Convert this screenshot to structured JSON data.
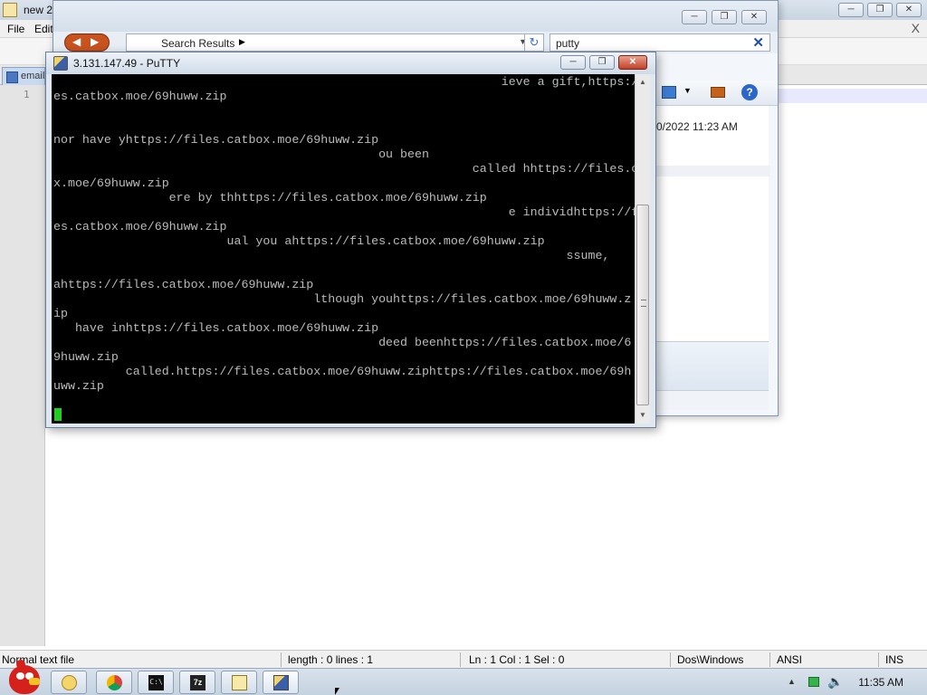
{
  "notepad": {
    "title": "new 2",
    "menu": {
      "file": "File",
      "edit": "Edit"
    },
    "close_glyph": "X",
    "tab_label": "email",
    "line_number": "1",
    "status": {
      "file_type": "Normal text file",
      "length_lines": "length : 0    lines : 1",
      "position": "Ln : 1    Col : 1    Sel : 0",
      "eol": "Dos\\Windows",
      "encoding": "ANSI",
      "mode": "INS"
    }
  },
  "explorer": {
    "address": "Search Results",
    "search_value": "putty",
    "date_text": "0/2022 11:23 AM",
    "icons": [
      "back-forward-icon",
      "refresh-icon",
      "clear-search-icon",
      "view-icon",
      "preview-pane-icon",
      "help-icon"
    ]
  },
  "putty": {
    "title": "3.131.147.49 - PuTTY",
    "terminal_lines": [
      "                                                              ieve a gift,https://fil",
      "es.catbox.moe/69huww.zip",
      "",
      "",
      "nor have yhttps://files.catbox.moe/69huww.zip",
      "                                             ou been",
      "                                                          called hhttps://files.catbo",
      "x.moe/69huww.zip",
      "                ere by thhttps://files.catbox.moe/69huww.zip",
      "                                                               e individhttps://fil",
      "es.catbox.moe/69huww.zip",
      "                        ual you ahttps://files.catbox.moe/69huww.zip",
      "                                                                       ssume,",
      "",
      "ahttps://files.catbox.moe/69huww.zip",
      "                                    lthough youhttps://files.catbox.moe/69huww.z",
      "ip",
      "   have inhttps://files.catbox.moe/69huww.zip",
      "                                             deed beenhttps://files.catbox.moe/6",
      "9huww.zip",
      "          called.https://files.catbox.moe/69huww.ziphttps://files.catbox.moe/69h",
      "uww.zip"
    ]
  },
  "taskbar": {
    "clock": "11:35 AM",
    "apps": [
      "start-button",
      "explorer-icon",
      "chrome-icon",
      "cmd-icon",
      "7zip-icon",
      "notepadpp-icon",
      "putty-icon"
    ],
    "cmd_glyph": "C:\\",
    "zip_glyph": "7z"
  },
  "colors": {
    "terminal_bg": "#000000",
    "terminal_fg": "#bbbbbb",
    "cursor": "#22cc22",
    "close_button": "#c2412a"
  }
}
